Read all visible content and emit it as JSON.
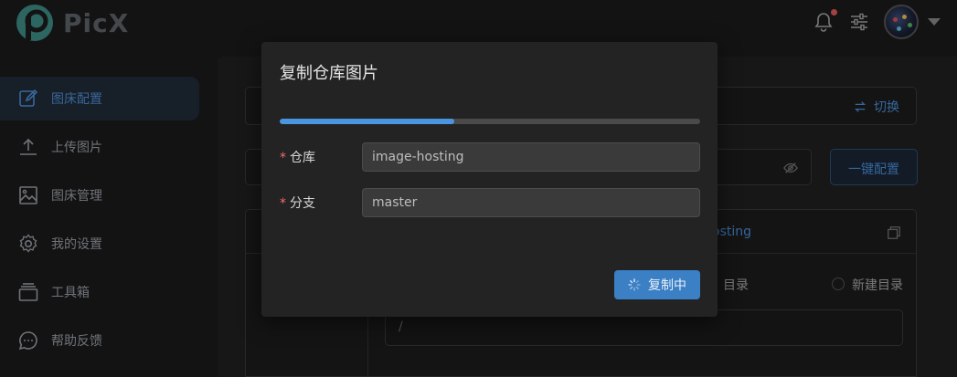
{
  "app": {
    "name": "PicX"
  },
  "sidebar": {
    "items": [
      {
        "label": "图床配置",
        "icon": "edit-icon",
        "active": true
      },
      {
        "label": "上传图片",
        "icon": "upload-icon",
        "active": false
      },
      {
        "label": "图床管理",
        "icon": "image-icon",
        "active": false
      },
      {
        "label": "我的设置",
        "icon": "gear-icon",
        "active": false
      },
      {
        "label": "工具箱",
        "icon": "toolbox-icon",
        "active": false
      },
      {
        "label": "帮助反馈",
        "icon": "chat-icon",
        "active": false
      }
    ]
  },
  "background": {
    "switch_label": "切换",
    "one_click_config_label": "一键配置",
    "repo_link_fragment": "osting",
    "dir_option_existing": "目录",
    "dir_option_new": "新建目录",
    "dir_path": "/"
  },
  "dialog": {
    "title": "复制仓库图片",
    "progress": 0.415,
    "fields": {
      "repo": {
        "label": "仓库",
        "value": "image-hosting"
      },
      "branch": {
        "label": "分支",
        "value": "master"
      }
    },
    "copy_button_label": "复制中"
  },
  "colors": {
    "accent": "#4a95e0",
    "required": "#f56c6c",
    "notification_dot": "#e25b5b"
  }
}
